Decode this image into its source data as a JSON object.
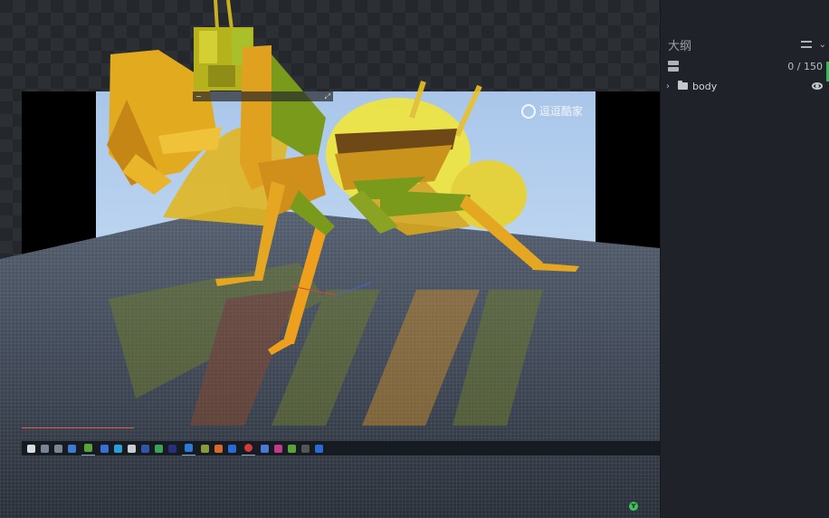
{
  "outliner": {
    "title": "大纲",
    "selection_count": "0 / 150",
    "tree": [
      {
        "label": "body",
        "expanded": false,
        "visible": true
      }
    ]
  },
  "viewport": {
    "watermark_text": "逗逗酷家",
    "gizmo_label": "Y"
  },
  "colors": {
    "panel_bg": "#1f2329",
    "accent_green": "#2bbd5a",
    "insect_yellow": "#e8a21a",
    "insect_green": "#7a9a1c"
  }
}
